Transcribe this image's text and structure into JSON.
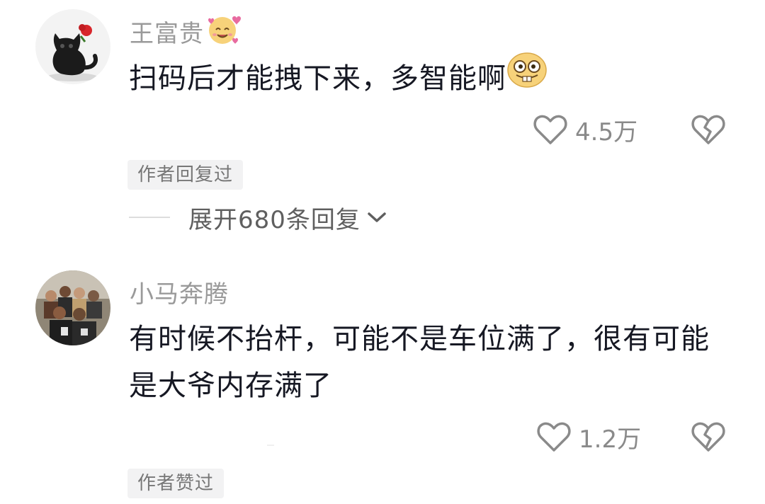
{
  "comments": [
    {
      "username": "王富贵",
      "username_emoji": "smiling-face-with-hearts-icon",
      "text": "扫码后才能拽下来，多智能啊",
      "text_emoji": "silly-buck-teeth-face-icon",
      "likes": "4.5万",
      "badge": "作者回复过",
      "expand_replies": "展开680条回复"
    },
    {
      "username": "小马奔腾",
      "text": "有时候不抬杆，可能不是车位满了，很有可能是大爷内存满了",
      "likes": "1.2万",
      "badge": "作者赞过"
    }
  ],
  "colors": {
    "username": "#9a9a9a",
    "text": "#161823",
    "meta": "#8a8a8a",
    "badge_bg": "#f2f2f3"
  }
}
